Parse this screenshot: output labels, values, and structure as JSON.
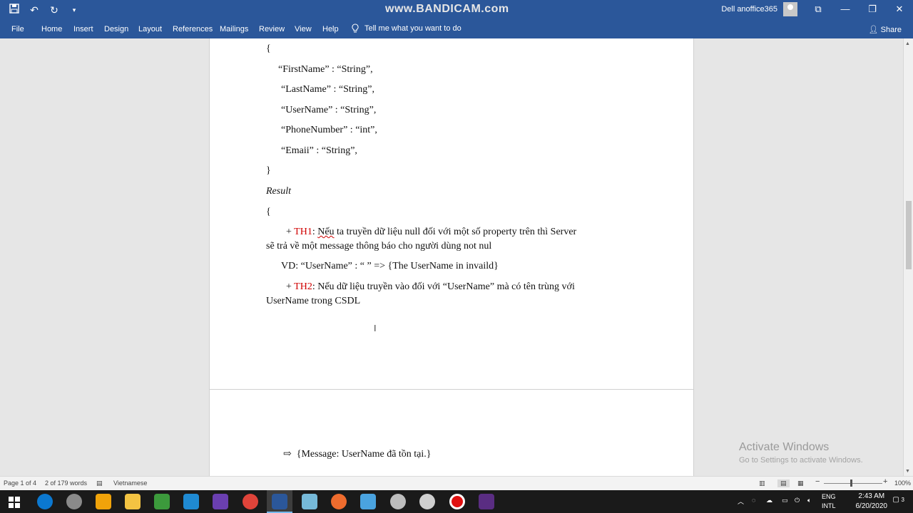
{
  "titlebar": {
    "watermark": "www.BANDICAM.com",
    "user": "Dell anoffice365",
    "qat_icons": [
      "save-icon",
      "undo-icon",
      "redo-icon",
      "customize-icon"
    ],
    "window_buttons": [
      "ribbon-display-icon",
      "minimize-icon",
      "restore-icon",
      "close-icon"
    ]
  },
  "ribbon": {
    "tabs": [
      "File",
      "Home",
      "Insert",
      "Design",
      "Layout",
      "References",
      "Mailings",
      "Review",
      "View",
      "Help"
    ],
    "tellme": "Tell me what you want to do",
    "share": "Share"
  },
  "document": {
    "page1": {
      "brace_open": "{",
      "fields": [
        "“FirstName” : “String”,",
        "“LastName” : “String”,",
        "“UserName” : “String”,",
        "“PhoneNumber” : “int”,",
        "“Emaii” : “String”,"
      ],
      "brace_close": "}",
      "result_label": "Result",
      "result_open": "{",
      "th1_prefix": "+ ",
      "th1_label": "TH1",
      "th1_colon": ": ",
      "th1_first": "Nếu",
      "th1_rest": " ta truyền dữ liệu null đối với một số property trên thì Server",
      "th1_line2": "sẽ trả về một message thông báo cho người dùng not nul",
      "vd": "VD: “UserName” : “ ” => {The UserName in invaild}",
      "th2_prefix": "+ ",
      "th2_label": "TH2",
      "th2_rest": ": Nếu dữ liệu truyền vào  đối với “UserName” mà có tên trùng với",
      "th2_line2": "UserName trong CSDL"
    },
    "page2": {
      "arrow": "⇨",
      "message": "{Message: UserName đã tồn tại.}"
    }
  },
  "activation": {
    "title": "Activate Windows",
    "subtitle": "Go to Settings to activate Windows."
  },
  "statusbar": {
    "page": "Page 1 of 4",
    "words": "2 of 179 words",
    "language": "Vietnamese",
    "zoom": "100%",
    "zoom_level": 1.0
  },
  "taskbar": {
    "apps": [
      "start-icon",
      "edge-icon",
      "settings-gear-icon",
      "app-icon",
      "file-explorer-icon",
      "notepad-icon",
      "vscode-icon",
      "visual-studio-icon",
      "chrome-icon",
      "word-icon",
      "app-icon",
      "postman-icon",
      "app-icon",
      "settings-icon",
      "app-icon",
      "record-icon",
      "terminal-icon"
    ],
    "lang1": "ENG",
    "lang2": "INTL",
    "time": "2:43 AM",
    "date": "6/20/2020",
    "notifications": "3"
  },
  "colors": {
    "accent": "#2b579a",
    "red_text": "#d00000",
    "taskbar": "#1a1a1a"
  }
}
